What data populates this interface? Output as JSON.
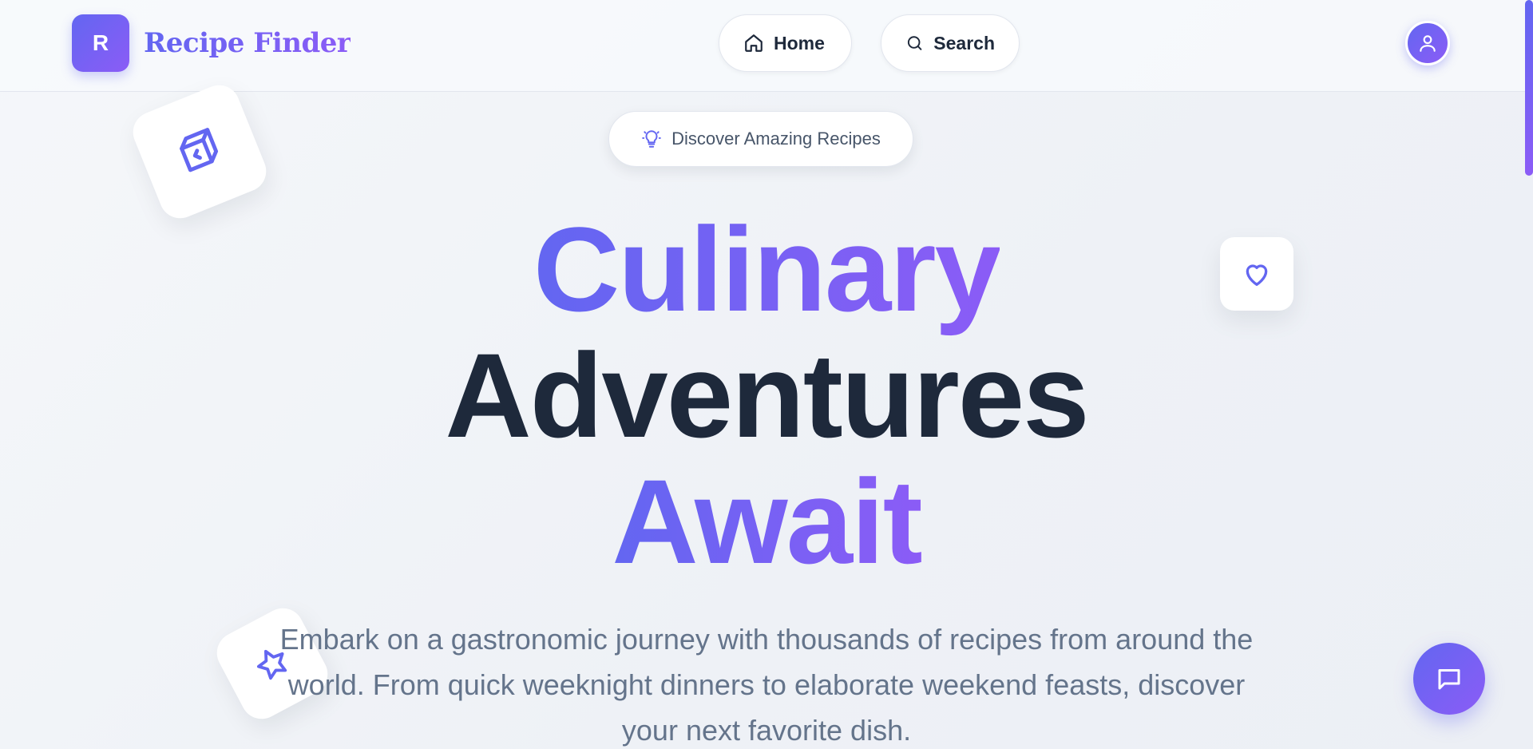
{
  "brand": {
    "logo_letter": "R",
    "name": "Recipe Finder"
  },
  "nav": {
    "home": {
      "label": "Home",
      "icon": "home-icon"
    },
    "search": {
      "label": "Search",
      "icon": "search-icon"
    }
  },
  "badge": {
    "label": "Discover Amazing Recipes",
    "icon": "lightbulb-icon"
  },
  "hero": {
    "line1": "Culinary",
    "line2": "Adventures",
    "line3": "Await",
    "subtitle": "Embark on a gastronomic journey with thousands of recipes from around the world. From quick weeknight dinners to elaborate weekend feasts, discover your next favorite dish."
  },
  "floating_icons": [
    "cube-icon",
    "heart-icon",
    "star-icon"
  ],
  "colors": {
    "accent": "#6366f1",
    "accent_2": "#8b5cf6",
    "text_dark": "#1e293b",
    "text_muted": "#64748b"
  }
}
